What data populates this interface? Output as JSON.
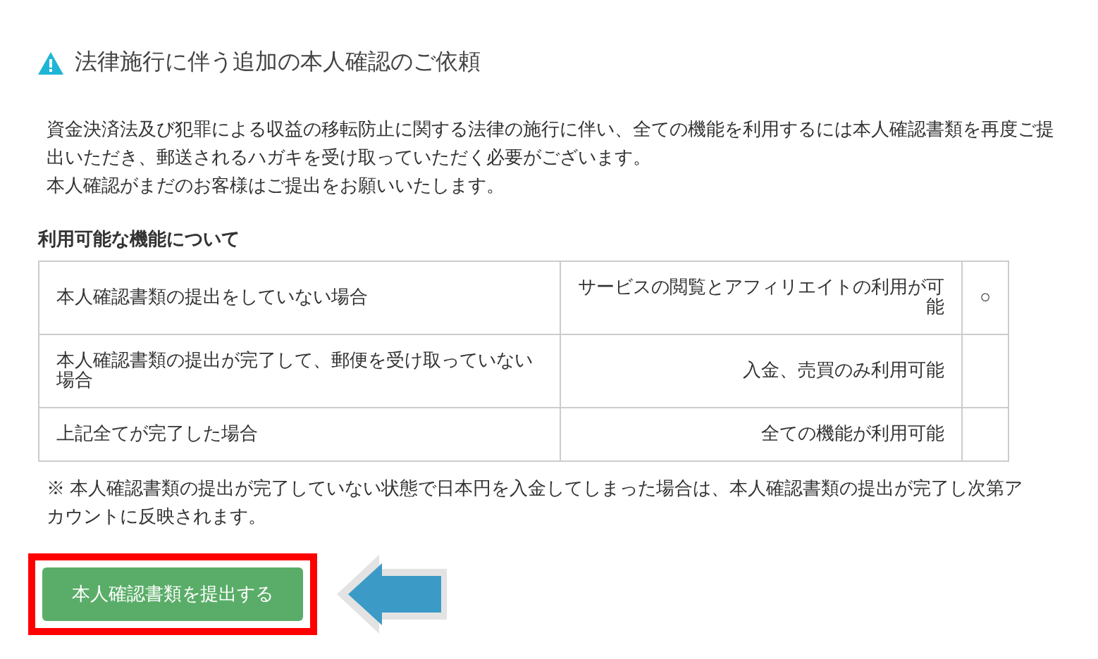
{
  "title": "法律施行に伴う追加の本人確認のご依頼",
  "paragraphs": [
    "資金決済法及び犯罪による収益の移転防止に関する法律の施行に伴い、全ての機能を利用するには本人確認書類を再度ご提出いただき、郵送されるハガキを受け取っていただく必要がございます。",
    "本人確認がまだのお客様はご提出をお願いいたします。"
  ],
  "section_title": "利用可能な機能について",
  "table": {
    "rows": [
      {
        "condition": "本人確認書類の提出をしていない場合",
        "features": "サービスの閲覧とアフィリエイトの利用が可能",
        "mark": "○"
      },
      {
        "condition": "本人確認書類の提出が完了して、郵便を受け取っていない場合",
        "features": "入金、売買のみ利用可能"
      },
      {
        "condition": "上記全てが完了した場合",
        "features": "全ての機能が利用可能"
      }
    ]
  },
  "note": "※ 本人確認書類の提出が完了していない状態で日本円を入金してしまった場合は、本人確認書類の提出が完了し次第アカウントに反映されます。",
  "button": {
    "label": "本人確認書類を提出する",
    "highlighted": true
  }
}
